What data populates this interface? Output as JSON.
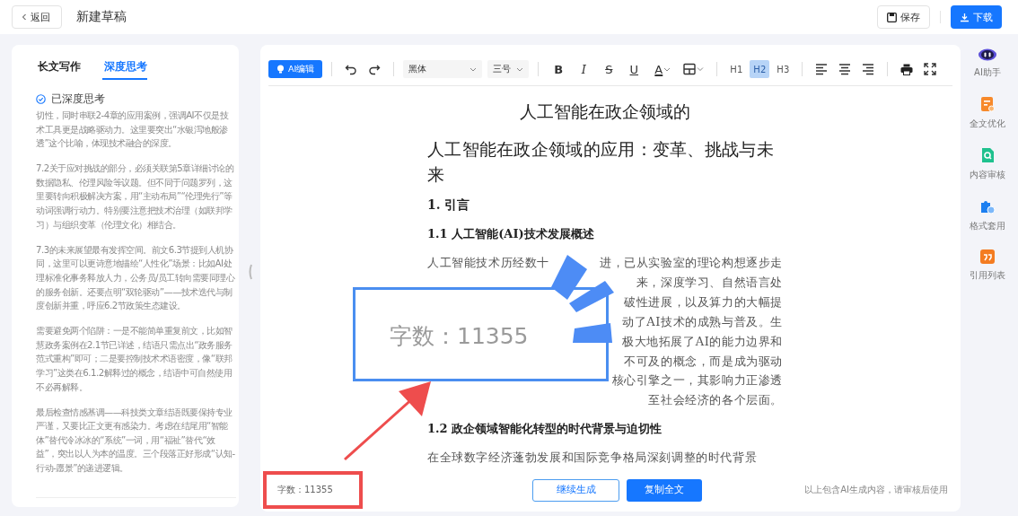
{
  "header": {
    "back_button": "返回",
    "title": "新建草稿",
    "save_button": "保存",
    "download_button": "下载"
  },
  "left_panel": {
    "tabs": [
      {
        "label": "长文写作",
        "selected": false
      },
      {
        "label": "深度思考",
        "selected": true
      }
    ],
    "status": "已深度思考",
    "paragraphs": [
      "切性，同时串联2-4章的应用案例，强调AI不仅是技术工具更是战略驱动力。这里要突出“水银泻地般渗透”这个比喻，体现技术融合的深度。",
      "7.2关于应对挑战的部分，必须关联第5章详细讨论的数据隐私、伦理风险等议题。但不同于问题罗列，这里要转向积极解决方案，用“主动布局”“伦理先行”等动词强调行动力。特别要注意把技术治理（如联邦学习）与组织变革（伦理文化）相结合。",
      "7.3的未来展望最有发挥空间。前文6.3节提到人机协同，这里可以更诗意地描绘“人性化”场景：比如AI处理标准化事务释放人力，公务员/员工转向需要同理心的服务创新。还要点明“双轮驱动”——技术迭代与制度创新并重，呼应6.2节政策生态建设。",
      "需要避免两个陷阱：一是不能简单重复前文，比如智慧政务案例在2.1节已详述，结语只需点出“政务服务范式重构”即可；二是要控制技术术语密度，像“联邦学习”这类在6.1.2解释过的概念，结语中可自然使用不必再解释。",
      "最后检查情感基调——科技类文章结语既要保持专业严谨，又要比正文更有感染力。考虑在结尾用“智能体”替代冷冰冰的“系统”一词，用“福祉”替代“效益”，突出以人为本的温度。三个段落正好形成“认知-行动-愿景”的递进逻辑。"
    ]
  },
  "toolbar": {
    "ai_button": "AI编辑",
    "font_select": "黑体",
    "size_select": "三号",
    "format_buttons": [
      {
        "kind": "bold",
        "label": "B"
      },
      {
        "kind": "italic",
        "label": "I"
      },
      {
        "kind": "strike",
        "label": "S"
      },
      {
        "kind": "underline",
        "label": "U"
      },
      {
        "kind": "color",
        "label": "A"
      }
    ],
    "headings": [
      {
        "label": "H1",
        "selected": false
      },
      {
        "label": "H2",
        "selected": true
      },
      {
        "label": "H3",
        "selected": false
      }
    ]
  },
  "document": [
    {
      "kind": "title",
      "text": "人工智能在政企领域的"
    },
    {
      "kind": "h1",
      "text": "人工智能在政企领域的应用：变革、挑战与未来"
    },
    {
      "kind": "h2",
      "text": "1. 引言"
    },
    {
      "kind": "h3",
      "text": "1.1 人工智能(AI)技术发展概述"
    },
    {
      "kind": "paragraph",
      "lines": [
        [
          "人工智能技术历经数十",
          "进，已从实验室的理论构想逐步走"
        ],
        [
          "来，深度学习、自然语言处"
        ],
        [
          "破性进展，以及算力的大幅提"
        ],
        [
          "动了AI技术的成熟与普及。生"
        ],
        [
          "极大地拓展了AI的能力边界和"
        ],
        [
          "不可及的概念，而是成为驱动"
        ],
        [
          "核心引擎之一，其影响力正渗透"
        ],
        [
          "至社会经济的各个层面。"
        ]
      ]
    },
    {
      "kind": "h3",
      "text": "1.2 政企领域智能化转型的时代背景与迫切性"
    },
    {
      "kind": "paragraph",
      "lines": [
        [
          "在全球数字经济蓬勃发展和国际竞争格局深刻调整的时代背景"
        ]
      ]
    }
  ],
  "footer": {
    "word_count": "字数：11355",
    "continue_button": "继续生成",
    "copy_button": "复制全文",
    "notice": "以上包含AI生成内容，请审核后使用"
  },
  "right_sidebar": [
    {
      "kind": "robot",
      "label": "AI助手"
    },
    {
      "kind": "optimize",
      "label": "全文优化"
    },
    {
      "kind": "review",
      "label": "内容审核"
    },
    {
      "kind": "format",
      "label": "格式套用"
    },
    {
      "kind": "quote",
      "label": "引用列表"
    }
  ],
  "callout": {
    "magnified_text": "字数：11355"
  }
}
